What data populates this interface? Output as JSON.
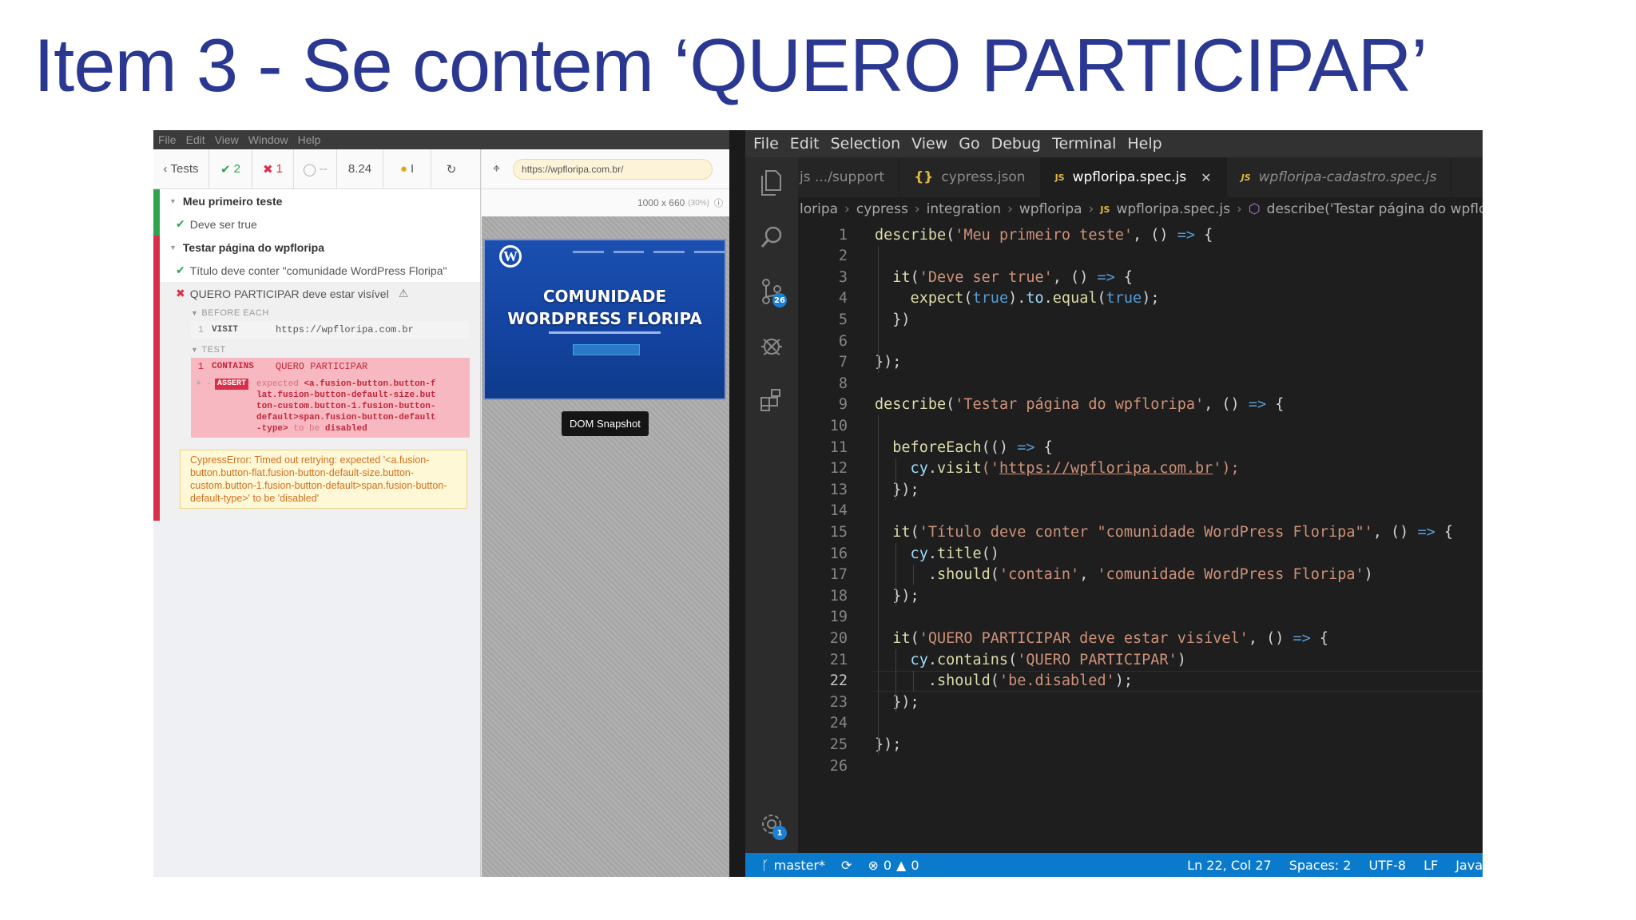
{
  "slide": {
    "title": "Item 3 - Se contem ‘QUERO PARTICIPAR’"
  },
  "cypress": {
    "menu": [
      "File",
      "Edit",
      "View",
      "Window",
      "Help"
    ],
    "stats": {
      "back_label": "Tests",
      "passed": "2",
      "failed": "1",
      "pending": "--",
      "duration": "8.24"
    },
    "tests": [
      {
        "label": "Meu primeiro teste",
        "kind": "suite"
      },
      {
        "label": "Deve ser true",
        "kind": "pass"
      },
      {
        "label": "Testar página do wpfloripa",
        "kind": "suite"
      },
      {
        "label": "Título deve conter \"comunidade WordPress Floripa\"",
        "kind": "pass"
      },
      {
        "label": "QUERO PARTICIPAR deve estar visível",
        "kind": "fail"
      }
    ],
    "before_each_label": "BEFORE EACH",
    "visit": {
      "num": "1",
      "name": "VISIT",
      "value": "https://wpfloripa.com.br"
    },
    "test_label": "TEST",
    "contains": {
      "num": "1",
      "name": "CONTAINS",
      "value": "QUERO PARTICIPAR"
    },
    "assert": {
      "badge": "ASSERT",
      "expected_word": "expected",
      "selector": "<a.fusion-button.button-flat.fusion-button-default-size.button-custom.button-1.fusion-button-default>span.fusion-button-default-type>",
      "to_be": "to be",
      "value": "disabled"
    },
    "error": "CypressError: Timed out retrying: expected '<a.fusion-button.button-flat.fusion-button-default-size.button-custom.button-1.fusion-button-default>span.fusion-button-default-type>' to be 'disabled'",
    "url": "https://wpfloripa.com.br/",
    "viewport": "1000 x 660",
    "viewport_pct": "(30%)",
    "preview_title_1": "COMUNIDADE",
    "preview_title_2": "WORDPRESS FLORIPA",
    "dom_snapshot": "DOM Snapshot"
  },
  "vscode": {
    "menu": [
      "File",
      "Edit",
      "Selection",
      "View",
      "Go",
      "Debug",
      "Terminal",
      "Help"
    ],
    "tabs": [
      {
        "label": "js  .../support",
        "icon": ""
      },
      {
        "label": "cypress.json",
        "icon": "{}"
      },
      {
        "label": "wpfloripa.spec.js",
        "icon": "JS",
        "active": true
      },
      {
        "label": "wpfloripa-cadastro.spec.js",
        "icon": "JS"
      }
    ],
    "breadcrumbs": [
      "loripa",
      "cypress",
      "integration",
      "wpfloripa",
      "wpfloripa.spec.js",
      "describe('Testar página do wpflori"
    ],
    "source_control_badge": "26",
    "settings_badge": "1",
    "status": {
      "branch": "master*",
      "errors": "0",
      "warnings": "0",
      "position": "Ln 22, Col 27",
      "spaces": "Spaces: 2",
      "encoding": "UTF-8",
      "eol": "LF",
      "language": "Java"
    },
    "current_line": 22,
    "code_lines": [
      "1",
      "2",
      "3",
      "4",
      "5",
      "6",
      "7",
      "8",
      "9",
      "10",
      "11",
      "12",
      "13",
      "14",
      "15",
      "16",
      "17",
      "18",
      "19",
      "20",
      "21",
      "22",
      "23",
      "24",
      "25",
      "26"
    ],
    "code": {
      "l1": [
        "describe",
        "(",
        "'Meu primeiro teste'",
        ", () ",
        "=>",
        " {"
      ],
      "l3": [
        "  it",
        "(",
        "'Deve ser true'",
        ", () ",
        "=>",
        " {"
      ],
      "l4": [
        "    expect",
        "(",
        "true",
        ").",
        "to",
        ".",
        "equal",
        "(",
        "true",
        ");"
      ],
      "l5": "  })",
      "l7": "});",
      "l9": [
        "describe",
        "(",
        "'Testar página do wpfloripa'",
        ", () ",
        "=>",
        " {"
      ],
      "l11": [
        "  beforeEach",
        "(() ",
        "=>",
        " {"
      ],
      "l12": [
        "    cy",
        ".",
        "visit",
        "('",
        "https://wpfloripa.com.br",
        "');"
      ],
      "l13": "  });",
      "l15": [
        "  it",
        "(",
        "'Título deve conter \"comunidade WordPress Floripa\"'",
        ", () ",
        "=>",
        " {"
      ],
      "l16": [
        "    cy",
        ".",
        "title",
        "()"
      ],
      "l17": [
        "      .",
        "should",
        "(",
        "'contain'",
        ", ",
        "'comunidade WordPress Floripa'",
        ")"
      ],
      "l18": "  });",
      "l20": [
        "  it",
        "(",
        "'QUERO PARTICIPAR deve estar visível'",
        ", () ",
        "=>",
        " {"
      ],
      "l21": [
        "    cy",
        ".",
        "contains",
        "(",
        "'QUERO PARTICIPAR'",
        ")"
      ],
      "l22": [
        "      .",
        "should",
        "(",
        "'be.disabled'",
        ");"
      ],
      "l23": "  });",
      "l25": "});"
    }
  },
  "colors": {
    "title": "#2b3891",
    "pass": "#2ea44f",
    "fail": "#d9304a",
    "vscode_status": "#0a7acc"
  }
}
